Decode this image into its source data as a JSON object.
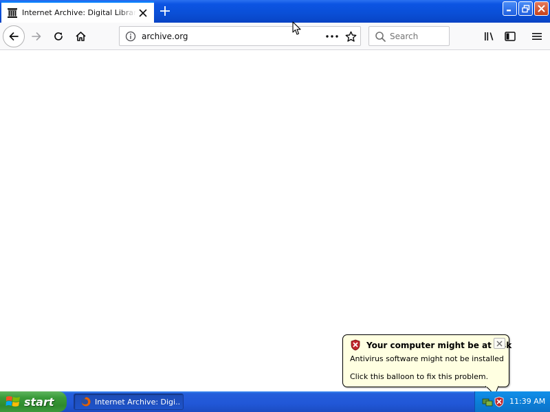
{
  "browser": {
    "tab": {
      "title": "Internet Archive: Digital Library of Free & Borrowable Books, Movies, Music & Wayback Machine",
      "favicon": "archive-building-icon"
    },
    "url": "archive.org",
    "search_placeholder": "Search",
    "icons": {
      "back": "back-arrow-icon",
      "forward": "forward-arrow-icon",
      "reload": "reload-icon",
      "home": "home-icon",
      "site_info": "info-icon",
      "page_actions": "more-dots-icon",
      "bookmark": "star-icon",
      "library": "library-icon",
      "sidebar": "sidebar-icon",
      "menu": "hamburger-menu-icon"
    },
    "accent_color": "#0a84ff"
  },
  "balloon": {
    "title": "Your computer might be at risk",
    "line1": "Antivirus software might not be installed",
    "line2": "Click this balloon to fix this problem.",
    "icon": "security-shield-icon",
    "background_color": "#ffffe1"
  },
  "taskbar": {
    "start_label": "start",
    "task_label": "Internet Archive: Digi...",
    "clock": "11:39 AM",
    "colors": {
      "taskbar": "#245edb",
      "start": "#3a9b3a",
      "tray": "#0c7fd8"
    }
  }
}
